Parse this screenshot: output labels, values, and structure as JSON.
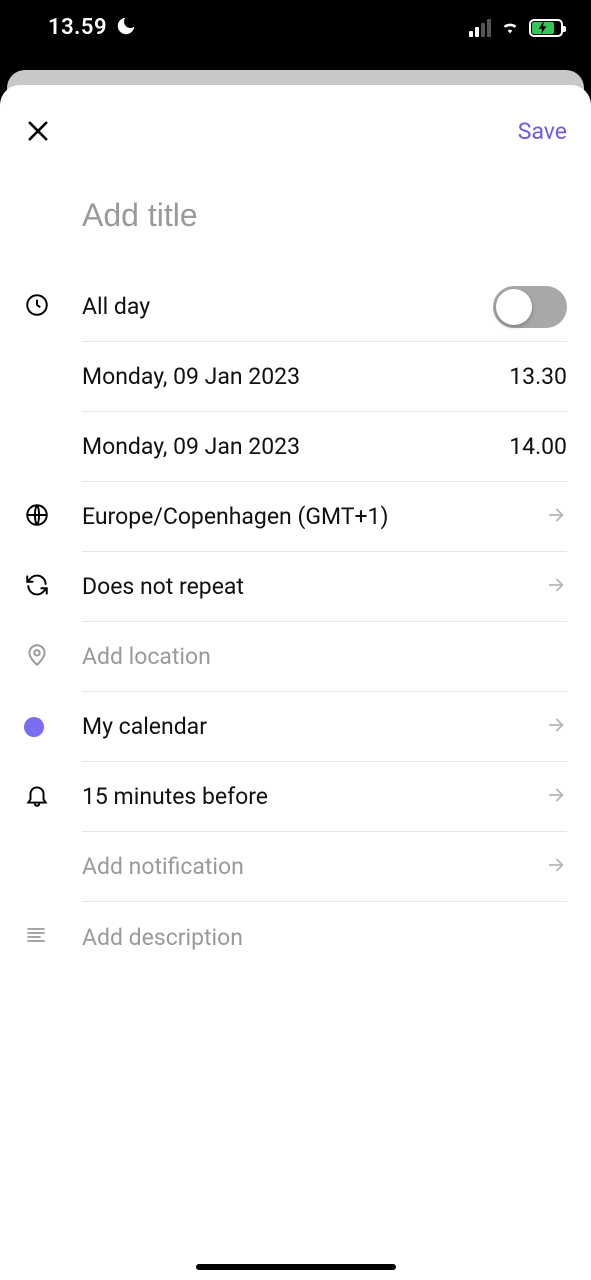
{
  "status": {
    "time": "13.59"
  },
  "header": {
    "save_label": "Save"
  },
  "title": {
    "placeholder": "Add title",
    "value": ""
  },
  "all_day": {
    "label": "All day",
    "enabled": false
  },
  "start": {
    "date": "Monday, 09 Jan 2023",
    "time": "13.30"
  },
  "end": {
    "date": "Monday, 09 Jan 2023",
    "time": "14.00"
  },
  "timezone": {
    "label": "Europe/Copenhagen (GMT+1)"
  },
  "repeat": {
    "label": "Does not repeat"
  },
  "location": {
    "placeholder": "Add location"
  },
  "calendar": {
    "label": "My calendar",
    "color": "#7a6df0"
  },
  "notification": {
    "label": "15 minutes before"
  },
  "add_notification": {
    "placeholder": "Add notification"
  },
  "description": {
    "placeholder": "Add description"
  }
}
